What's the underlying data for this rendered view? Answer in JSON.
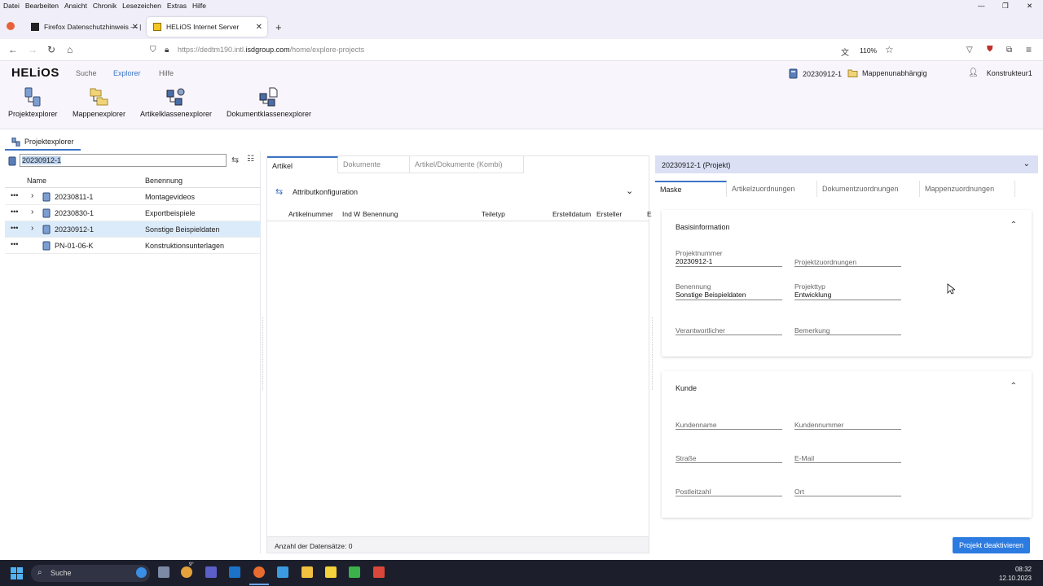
{
  "menubar": {
    "items": [
      "Datei",
      "Bearbeiten",
      "Ansicht",
      "Chronik",
      "Lesezeichen",
      "Extras",
      "Hilfe"
    ]
  },
  "browser": {
    "tabs": [
      {
        "title": "Firefox Datenschutzhinweis — |"
      },
      {
        "title": "HELiOS Internet Server"
      }
    ],
    "url_prefix": "https://dedtm190.intl.",
    "url_domain": "isdgroup.com",
    "url_path": "/home/explore-projects",
    "zoom": "110%"
  },
  "app": {
    "logo": "HELiOS",
    "nav": [
      "Suche",
      "Explorer",
      "Hilfe"
    ],
    "context_item": "20230912-1",
    "folder": "Mappenunabhängig",
    "user": "Konstrukteur1"
  },
  "toolbar": {
    "buttons": [
      "Projektexplorer",
      "Mappenexplorer",
      "Artikelklassenexplorer",
      "Dokumentklassenexplorer"
    ]
  },
  "section_tab": "Projektexplorer",
  "left": {
    "search_value": "20230912-1",
    "columns": [
      "Name",
      "Benennung"
    ],
    "rows": [
      {
        "name": "20230811-1",
        "benennung": "Montagevideos",
        "expandable": true,
        "selected": false
      },
      {
        "name": "20230830-1",
        "benennung": "Exportbeispiele",
        "expandable": true,
        "selected": false
      },
      {
        "name": "20230912-1",
        "benennung": "Sonstige Beispieldaten",
        "expandable": true,
        "selected": true
      },
      {
        "name": "PN-01-06-K",
        "benennung": "Konstruktionsunterlagen",
        "expandable": false,
        "selected": false
      }
    ],
    "row_menu": "•••"
  },
  "middle": {
    "tabs": [
      "Artikel",
      "Dokumente",
      "Artikel/Dokumente (Kombi)"
    ],
    "attr_config": "Attributkonfiguration",
    "columns": [
      "Artikelnummer",
      "Ind W",
      "Benennung",
      "Teiletyp",
      "Erstelldatum",
      "Ersteller",
      "E"
    ],
    "footer": "Anzahl der Datensätze: 0"
  },
  "right": {
    "header": "20230912-1 (Projekt)",
    "tabs": [
      "Maske",
      "Artikelzuordnungen",
      "Dokumentzuordnungen",
      "Mappenzuordnungen"
    ],
    "basis": {
      "title": "Basisinformation",
      "fields": {
        "projektnummer_label": "Projektnummer",
        "projektnummer": "20230912-1",
        "projektzuordnungen_label": "Projektzuordnungen",
        "projektzuordnungen": "",
        "benennung_label": "Benennung",
        "benennung": "Sonstige Beispieldaten",
        "projekttyp_label": "Projekttyp",
        "projekttyp": "Entwicklung",
        "verantwortlicher_label": "Verantwortlicher",
        "verantwortlicher": "",
        "bemerkung_label": "Bemerkung",
        "bemerkung": ""
      }
    },
    "kunde": {
      "title": "Kunde",
      "fields": {
        "kundenname_label": "Kundenname",
        "kundennummer_label": "Kundennummer",
        "strasse_label": "Straße",
        "email_label": "E-Mail",
        "plz_label": "Postleitzahl",
        "ort_label": "Ort"
      }
    },
    "deactivate_button": "Projekt deaktivieren"
  },
  "taskbar": {
    "search_placeholder": "Suche",
    "time": "08:32",
    "date": "12.10.2023",
    "weather_badge": "9°"
  },
  "colors": {
    "accent": "#3b74c4",
    "primary_button": "#2c7be0",
    "selection": "#dcebfa",
    "panel_header": "#dbe0f5"
  }
}
